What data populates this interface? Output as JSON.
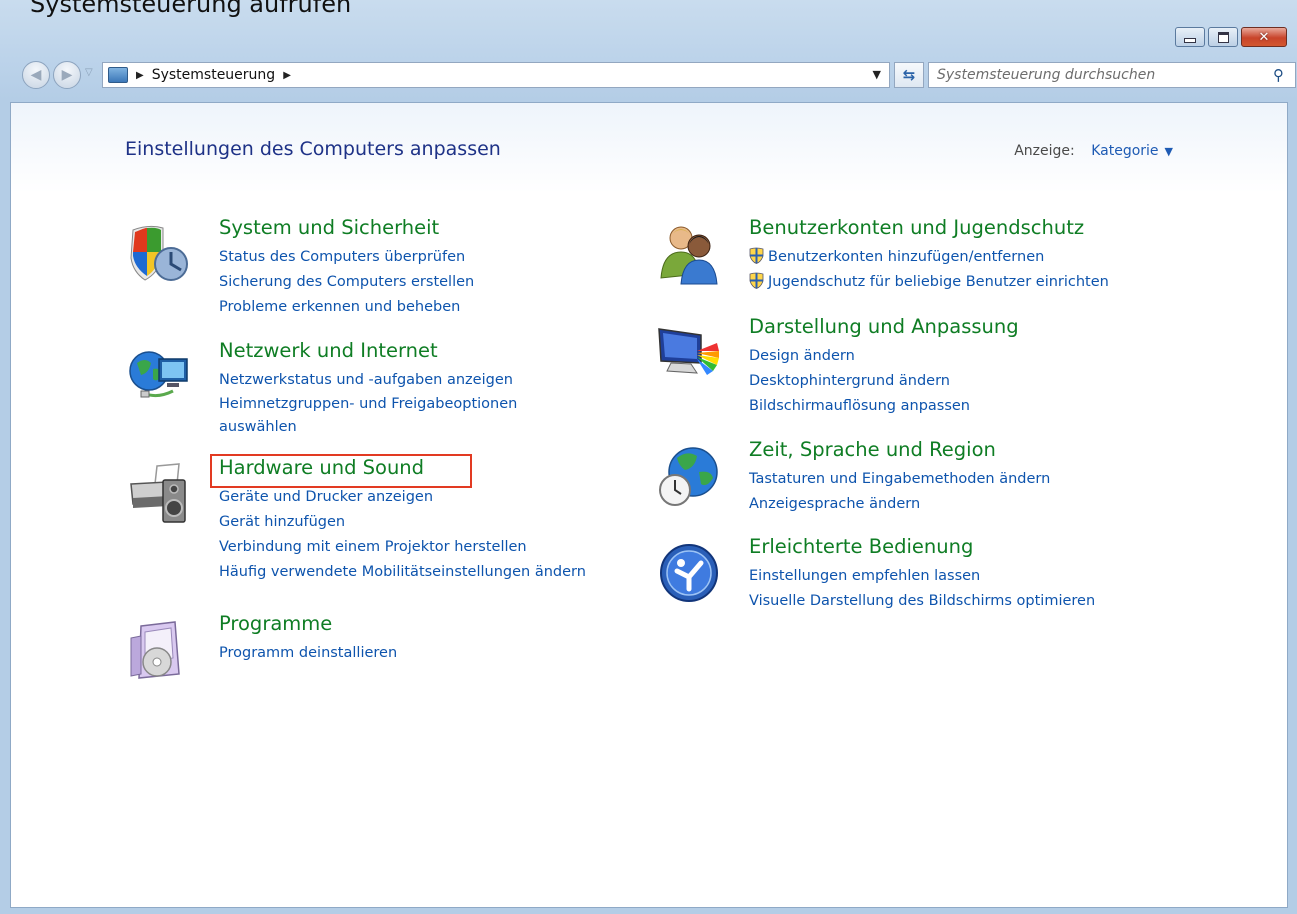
{
  "top_text": "Systemsteuerung aufrufen",
  "navigation": {
    "address_path": "Systemsteuerung",
    "search_placeholder": "Systemsteuerung durchsuchen"
  },
  "content": {
    "title": "Einstellungen des Computers anpassen",
    "view_label": "Anzeige:",
    "view_value": "Kategorie"
  },
  "categories_left": [
    {
      "title": "System und Sicherheit",
      "links": [
        "Status des Computers überprüfen",
        "Sicherung des Computers erstellen",
        "Probleme erkennen und beheben"
      ]
    },
    {
      "title": "Netzwerk und Internet",
      "links": [
        "Netzwerkstatus und -aufgaben anzeigen",
        "Heimnetzgruppen- und Freigabeoptionen auswählen"
      ]
    },
    {
      "title": "Hardware und Sound",
      "links": [
        "Geräte und Drucker anzeigen",
        "Gerät hinzufügen",
        "Verbindung mit einem Projektor herstellen",
        "Häufig verwendete Mobilitätseinstellungen ändern"
      ]
    },
    {
      "title": "Programme",
      "links": [
        "Programm deinstallieren"
      ]
    }
  ],
  "categories_right": [
    {
      "title": "Benutzerkonten und Jugendschutz",
      "links": [
        "Benutzerkonten hinzufügen/entfernen",
        "Jugendschutz für beliebige Benutzer einrichten"
      ]
    },
    {
      "title": "Darstellung und Anpassung",
      "links": [
        "Design ändern",
        "Desktophintergrund ändern",
        "Bildschirmauflösung anpassen"
      ]
    },
    {
      "title": "Zeit, Sprache und Region",
      "links": [
        "Tastaturen und Eingabemethoden ändern",
        "Anzeigesprache ändern"
      ]
    },
    {
      "title": "Erleichterte Bedienung",
      "links": [
        "Einstellungen empfehlen lassen",
        "Visuelle Darstellung des Bildschirms optimieren"
      ]
    }
  ],
  "colors": {
    "category_title": "#0f7d24",
    "link": "#0e54ad",
    "page_title": "#1e3287",
    "highlight": "#e23a22"
  },
  "icons": [
    "shield-security-icon",
    "network-globe-icon",
    "printer-speaker-icon",
    "programs-box-icon",
    "users-icon",
    "monitor-palette-icon",
    "globe-clock-icon",
    "ease-of-access-icon",
    "uac-shield-icon"
  ]
}
